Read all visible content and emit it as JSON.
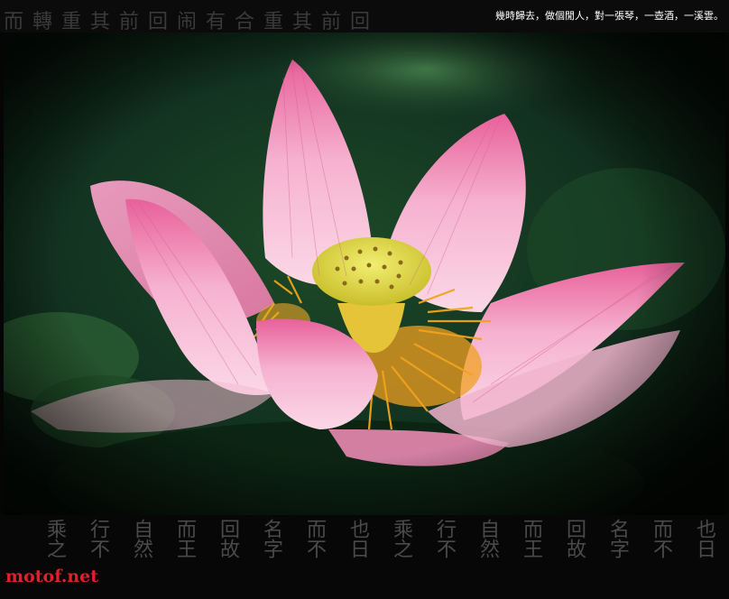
{
  "caption": "幾時歸去，做個閒人，對一張琴，一壺酒，一溪雲。",
  "watermark": "motof.net",
  "top_calligraphy": "而轉重其前回闹有合重其前回",
  "bottom_calligraphy_columns": [
    "乘之",
    "行不",
    "自然",
    "而王",
    "回故",
    "名字",
    "而不",
    "也日",
    "乘之",
    "行不",
    "自然",
    "而王",
    "回故",
    "名字",
    "而不",
    "也日"
  ],
  "photo": {
    "subject": "pink lotus flower with yellow seed pod and stamens",
    "colors": {
      "petal": "#f4a6c8",
      "petal_tip": "#e0567f",
      "seed_pod": "#e8e04a",
      "stamen": "#f2a418",
      "background_dark": "#0e2414",
      "background_leaf": "#2f6b3a"
    }
  }
}
